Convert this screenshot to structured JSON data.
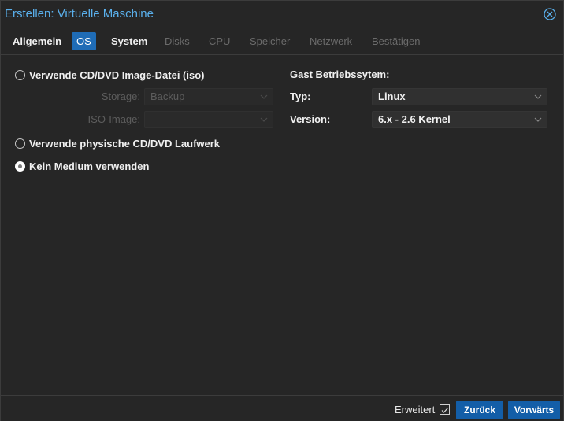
{
  "window": {
    "title": "Erstellen: Virtuelle Maschine"
  },
  "tabs": [
    {
      "label": "Allgemein",
      "state": "normal"
    },
    {
      "label": "OS",
      "state": "active"
    },
    {
      "label": "System",
      "state": "normal"
    },
    {
      "label": "Disks",
      "state": "disabled"
    },
    {
      "label": "CPU",
      "state": "disabled"
    },
    {
      "label": "Speicher",
      "state": "disabled"
    },
    {
      "label": "Netzwerk",
      "state": "disabled"
    },
    {
      "label": "Bestätigen",
      "state": "disabled"
    }
  ],
  "media": {
    "option_iso": "Verwende CD/DVD Image-Datei (iso)",
    "storage_label": "Storage:",
    "storage_value": "Backup",
    "iso_label": "ISO-Image:",
    "iso_value": "",
    "option_physical": "Verwende physische CD/DVD Laufwerk",
    "option_none": "Kein Medium verwenden",
    "selected": "option_none"
  },
  "guest_os": {
    "section_title": "Gast Betriebssytem:",
    "type_label": "Typ:",
    "type_value": "Linux",
    "version_label": "Version:",
    "version_value": "6.x - 2.6 Kernel"
  },
  "footer": {
    "advanced_label": "Erweitert",
    "advanced_checked": true,
    "back_label": "Zurück",
    "next_label": "Vorwärts"
  },
  "colors": {
    "accent": "#1f6cb6",
    "title": "#5ab0ec",
    "background": "#262626"
  }
}
